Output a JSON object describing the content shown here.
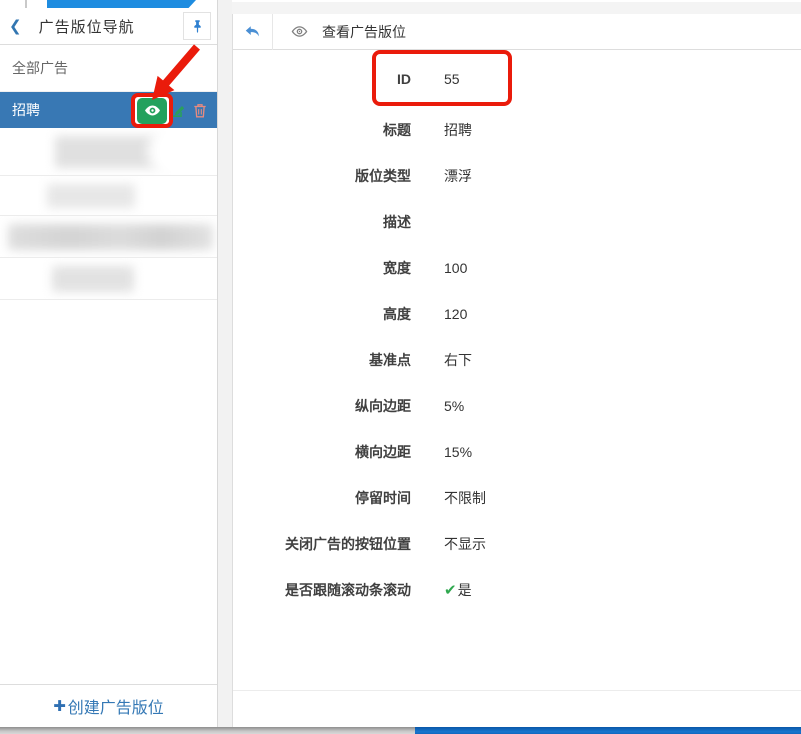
{
  "sidebar": {
    "back_chevron": "❮",
    "title": "广告版位导航",
    "all_ads_label": "全部广告",
    "selected_item": {
      "label": "招聘"
    },
    "create_button": {
      "plus": "✚",
      "label": "创建广告版位"
    }
  },
  "main": {
    "header": {
      "title": "查看广告版位"
    },
    "fields": [
      {
        "label": "ID",
        "value": "55",
        "highlighted": true
      },
      {
        "label": "标题",
        "value": "招聘"
      },
      {
        "label": "版位类型",
        "value": "漂浮"
      },
      {
        "label": "描述",
        "value": ""
      },
      {
        "label": "宽度",
        "value": "100"
      },
      {
        "label": "高度",
        "value": "120"
      },
      {
        "label": "基准点",
        "value": "右下"
      },
      {
        "label": "纵向边距",
        "value": "5%"
      },
      {
        "label": "横向边距",
        "value": "15%"
      },
      {
        "label": "停留时间",
        "value": "不限制"
      },
      {
        "label": "关闭广告的按钮位置",
        "value": "不显示"
      },
      {
        "label": "是否跟随滚动条滚动",
        "value": "是",
        "check": true
      }
    ],
    "check_glyph": "✔"
  },
  "colors": {
    "selected_row_blue": "#3878b4",
    "tab_blue": "#1e8ce0",
    "link_blue": "#3478b5",
    "annotation_red": "#ea1b0b",
    "action_green": "#23a15d",
    "trash_red": "#e88b80",
    "check_green": "#2fa84f",
    "bottom_bar_blue": "#1166bd"
  }
}
